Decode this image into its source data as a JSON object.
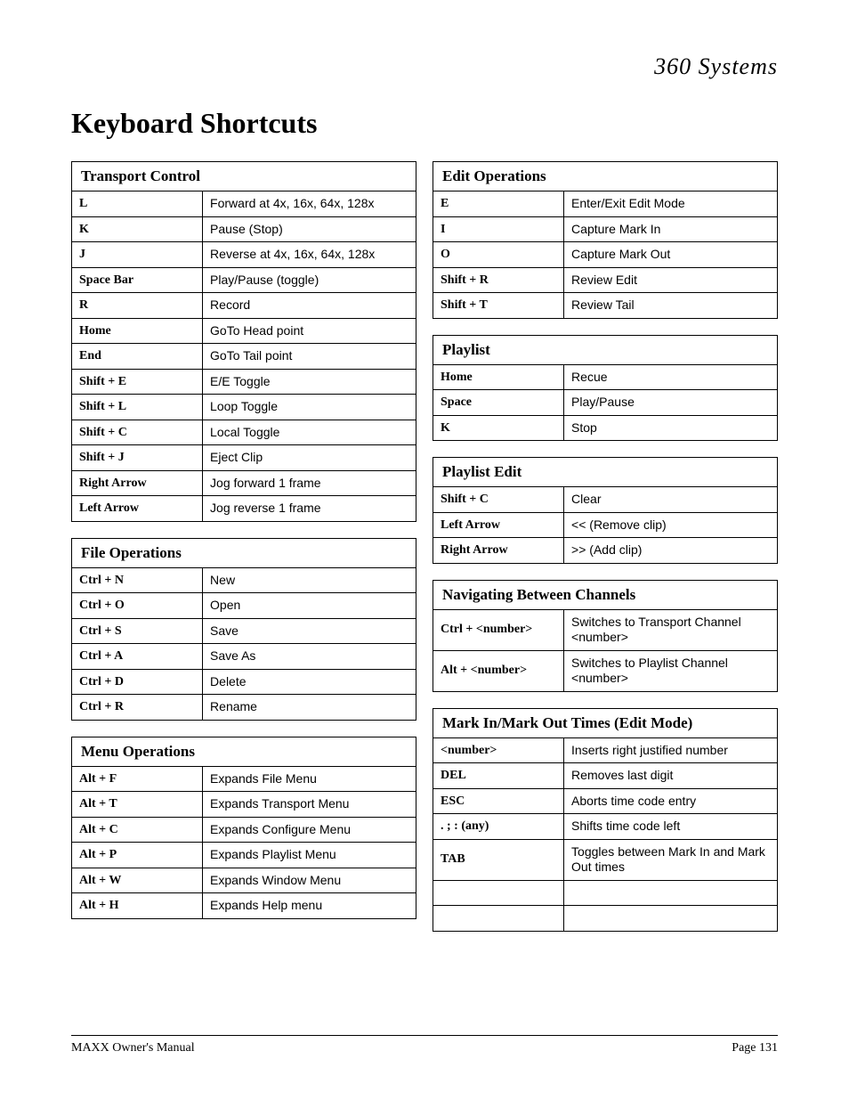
{
  "brand": "360 Systems",
  "title": "Keyboard Shortcuts",
  "footer_left": "MAXX Owner's Manual",
  "footer_right": "Page 131",
  "left": [
    {
      "header": "Transport Control",
      "rows": [
        {
          "key": "L",
          "desc": "Forward at 4x, 16x, 64x, 128x"
        },
        {
          "key": "K",
          "desc": "Pause (Stop)"
        },
        {
          "key": "J",
          "desc": "Reverse at 4x, 16x, 64x, 128x"
        },
        {
          "key": "Space Bar",
          "desc": "Play/Pause (toggle)"
        },
        {
          "key": "R",
          "desc": "Record"
        },
        {
          "key": "Home",
          "desc": "GoTo Head point"
        },
        {
          "key": "End",
          "desc": "GoTo Tail point"
        },
        {
          "key": "Shift + E",
          "desc": "E/E Toggle"
        },
        {
          "key": "Shift + L",
          "desc": "Loop Toggle"
        },
        {
          "key": "Shift + C",
          "desc": "Local Toggle"
        },
        {
          "key": "Shift + J",
          "desc": "Eject Clip"
        },
        {
          "key": "Right Arrow",
          "desc": "Jog forward 1 frame"
        },
        {
          "key": "Left Arrow",
          "desc": "Jog reverse 1 frame"
        }
      ]
    },
    {
      "header": "File Operations",
      "rows": [
        {
          "key": "Ctrl + N",
          "desc": "New"
        },
        {
          "key": "Ctrl + O",
          "desc": "Open"
        },
        {
          "key": "Ctrl + S",
          "desc": "Save"
        },
        {
          "key": "Ctrl + A",
          "desc": "Save As"
        },
        {
          "key": "Ctrl + D",
          "desc": "Delete"
        },
        {
          "key": "Ctrl + R",
          "desc": "Rename"
        }
      ]
    },
    {
      "header": "Menu Operations",
      "rows": [
        {
          "key": "Alt + F",
          "desc": "Expands File Menu"
        },
        {
          "key": "Alt + T",
          "desc": "Expands Transport Menu"
        },
        {
          "key": "Alt + C",
          "desc": "Expands Configure Menu"
        },
        {
          "key": "Alt + P",
          "desc": "Expands Playlist Menu"
        },
        {
          "key": "Alt + W",
          "desc": "Expands Window Menu"
        },
        {
          "key": "Alt + H",
          "desc": "Expands Help menu"
        }
      ]
    }
  ],
  "right": [
    {
      "header": "Edit Operations",
      "rows": [
        {
          "key": "E",
          "desc": "Enter/Exit Edit Mode"
        },
        {
          "key": "I",
          "desc": "Capture Mark In"
        },
        {
          "key": "O",
          "desc": "Capture Mark Out"
        },
        {
          "key": "Shift + R",
          "desc": "Review Edit"
        },
        {
          "key": "Shift + T",
          "desc": "Review Tail"
        }
      ]
    },
    {
      "header": "Playlist",
      "rows": [
        {
          "key": "Home",
          "desc": "Recue"
        },
        {
          "key": "Space",
          "desc": "Play/Pause"
        },
        {
          "key": "K",
          "desc": "Stop"
        }
      ]
    },
    {
      "header": "Playlist Edit",
      "rows": [
        {
          "key": "Shift + C",
          "desc": "Clear"
        },
        {
          "key": "Left Arrow",
          "desc": "<< (Remove clip)"
        },
        {
          "key": "Right Arrow",
          "desc": ">> (Add clip)"
        }
      ]
    },
    {
      "header": "Navigating Between Channels",
      "rows": [
        {
          "key": "Ctrl + <number>",
          "desc": "Switches to Transport Channel <number>"
        },
        {
          "key": "Alt + <number>",
          "desc": "Switches to Playlist Channel <number>"
        }
      ]
    },
    {
      "header": "Mark In/Mark Out Times (Edit Mode)",
      "rows": [
        {
          "key": "<number>",
          "desc": "Inserts right justified number"
        },
        {
          "key": "DEL",
          "desc": "Removes last digit"
        },
        {
          "key": "ESC",
          "desc": "Aborts time code entry"
        },
        {
          "key": ". ; :  (any)",
          "desc": "Shifts time code left"
        },
        {
          "key": "TAB",
          "desc": "Toggles between Mark In and Mark Out times"
        },
        {
          "key": "",
          "desc": ""
        },
        {
          "key": "",
          "desc": ""
        }
      ]
    }
  ]
}
